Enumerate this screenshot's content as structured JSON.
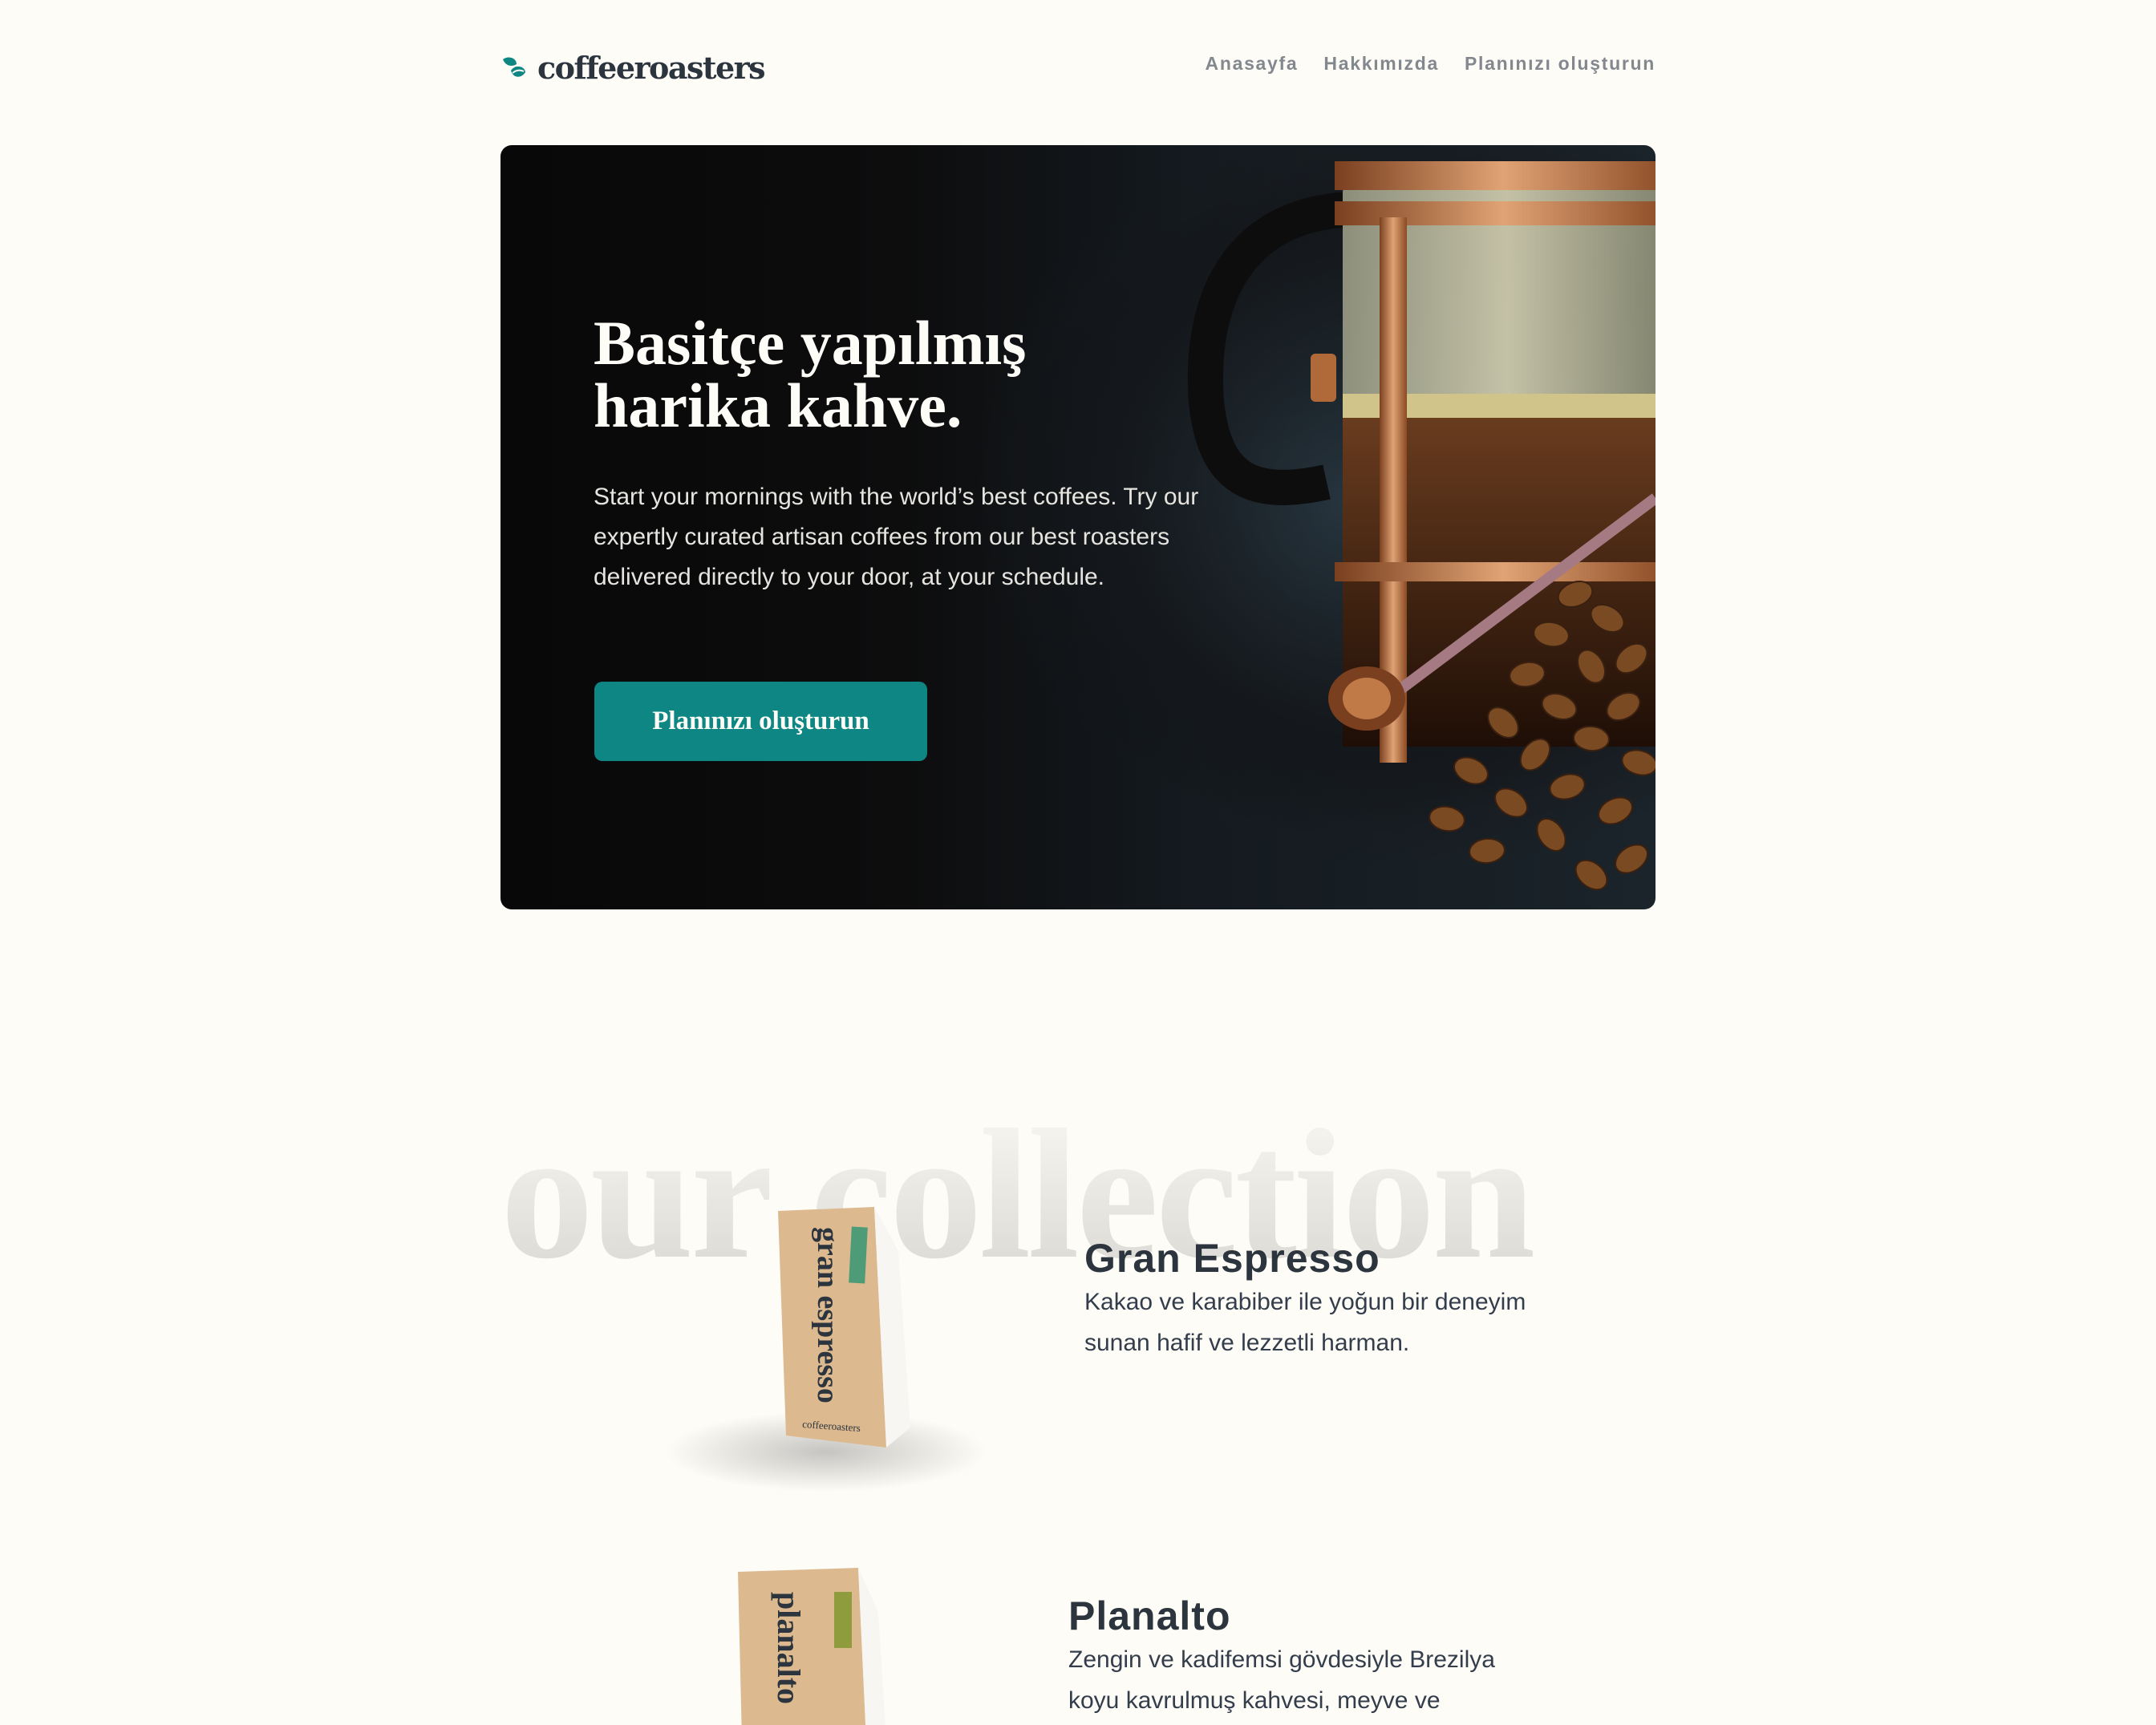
{
  "header": {
    "logo_text": "coffeeroasters",
    "nav": [
      "Anasayfa",
      "Hakkımızda",
      "Planınızı oluşturun"
    ]
  },
  "hero": {
    "title_line1": "Basitçe yapılmış",
    "title_line2": "harika kahve.",
    "text": "Start your mornings with the world’s best coffees. Try our expertly curated artisan coffees from our best roasters delivered directly to your door, at your schedule.",
    "cta": "Planınızı oluşturun"
  },
  "collection": {
    "heading": "our collection",
    "products": [
      {
        "name": "Gran Espresso",
        "description": "Kakao ve karabiber ile yoğun bir deneyim sunan hafif ve lezzetli harman.",
        "bag_label": "gran espresso",
        "accent": "#4e9b78"
      },
      {
        "name": "Planalto",
        "description": "Zengin ve kadifemsi gövdesiyle Brezilya koyu kavrulmuş kahvesi, meyve ve",
        "bag_label": "planalto",
        "accent": "#8e9c3d"
      }
    ]
  },
  "colors": {
    "accent": "#0e8784",
    "dark_text": "#2c343e",
    "page_bg": "#fdfcf7"
  }
}
